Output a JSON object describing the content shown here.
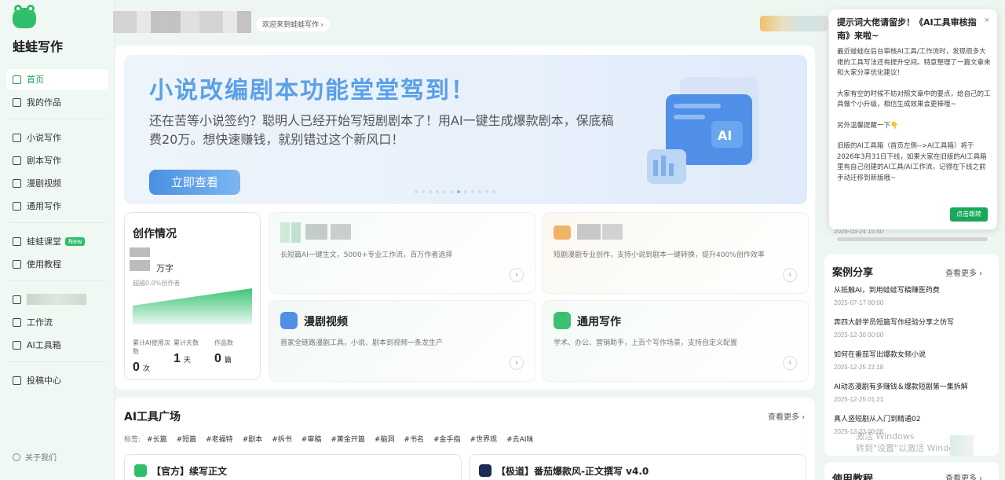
{
  "app": {
    "name": "蛙蛙写作"
  },
  "sidebar": {
    "items": [
      {
        "label": "首页",
        "icon": "home-icon",
        "active": true
      },
      {
        "label": "我的作品",
        "icon": "book-icon"
      },
      {
        "label": "小说写作",
        "icon": "novel-icon"
      },
      {
        "label": "剧本写作",
        "icon": "script-icon"
      },
      {
        "label": "漫剧视频",
        "icon": "video-icon"
      },
      {
        "label": "通用写作",
        "icon": "edit-icon"
      },
      {
        "label": "蛙蛙课堂",
        "icon": "graduation-icon",
        "badge": "New"
      },
      {
        "label": "使用教程",
        "icon": "info-icon"
      },
      {
        "label": "工作流",
        "icon": "workflow-icon"
      },
      {
        "label": "AI工具箱",
        "icon": "toolbox-icon"
      },
      {
        "label": "投稿中心",
        "icon": "submit-icon"
      }
    ],
    "about": "关于我们"
  },
  "header": {
    "welcome": "欢迎来到蛙蛙写作 ›"
  },
  "banner": {
    "title": "小说改编剧本功能堂堂驾到！",
    "desc": "还在苦等小说签约？聪明人已经开始写短剧剧本了！用AI一键生成爆款剧本，保底稿费20万。想快速赚钱，就别错过这个新风口！",
    "button": "立即查看"
  },
  "stats": {
    "title": "创作情况",
    "unit": "万字",
    "sub": "超越0.0%创作者",
    "cols": [
      {
        "label": "累计AI使用次数",
        "value": "0",
        "unit": "次"
      },
      {
        "label": "累计天数",
        "value": "1",
        "unit": "天"
      },
      {
        "label": "作品数",
        "value": "0",
        "unit": "篇"
      }
    ]
  },
  "features": [
    {
      "title": "",
      "desc": "长短篇AI一键生文，5000+专业工作流，百万作者选择"
    },
    {
      "title": "",
      "desc": "短剧漫剧专业创作，支持小说到剧本一键转换，提升400%创作效率"
    },
    {
      "title": "漫剧视频",
      "desc": "首家全链路漫剧工具，小说、剧本到视频一条龙生产"
    },
    {
      "title": "通用写作",
      "desc": "学术、办公、营销助手，上百个写作场景，支持自定义配置"
    }
  ],
  "tools": {
    "title": "AI工具广场",
    "more": "查看更多 ›",
    "tag_label": "标签:",
    "tags": [
      "#长篇",
      "#短篇",
      "#老福特",
      "#剧本",
      "#拆书",
      "#审稿",
      "#黄金开篇",
      "#脑洞",
      "#书名",
      "#金手指",
      "#世界观",
      "#去AI味"
    ],
    "cards": [
      {
        "name": "【官方】续写正文"
      },
      {
        "name": "【极道】番茄爆款风-正文撰写 v4.0"
      }
    ]
  },
  "popup": {
    "title": "提示词大佬请留步！《AI工具审核指南》来啦~",
    "close": "×",
    "paragraphs": [
      "最近蛙蛙在后台审核AI工具/工作流时，发现很多大佬的工具写法还有提升空间。特意整理了一篇文章来和大家分享优化建议！",
      "大家有空的时候不妨对照文章中的要点，给自己的工具做个小升级，相信生成效果会更棒哦~",
      "另外温馨提醒一下👇",
      "旧版的AI工具箱（首页左侧-->AI工具箱）将于2026年3月31日下线，如果大家在旧版的AI工具箱里有自己创建的AI工具/AI工作流，记得在下线之前手动迁移到新版哦~"
    ],
    "button": "点击跳转",
    "behind_date": "2026-03-24 15:40"
  },
  "cases": {
    "title": "案例分享",
    "more": "查看更多 ›",
    "items": [
      {
        "title": "从抵触AI，到用蛙蛙写稿赚医药费",
        "date": "2025-07-17 00:00"
      },
      {
        "title": "奔四大龄学员短篇写作经验分享之仿写",
        "date": "2025-12-30 00:00"
      },
      {
        "title": "如何在番茄写出爆款女频小说",
        "date": "2025-12-25 22:18"
      },
      {
        "title": "AI动态漫剧有多赚钱＆爆款短剧第一集拆解",
        "date": "2025-12-25 01:21"
      },
      {
        "title": "真人竖短剧从入门到精通02",
        "date": "2025-12-23 00:00"
      }
    ]
  },
  "tutorial": {
    "title": "使用教程",
    "more": "查看更多 ›"
  },
  "watermark": {
    "line1": "激活 Windows",
    "line2": "转到\"设置\"以激活 Windows。"
  },
  "colors": {
    "accent": "#2fbf6a",
    "banner_title": "#5aa0e8",
    "button": "#4a90e2"
  }
}
